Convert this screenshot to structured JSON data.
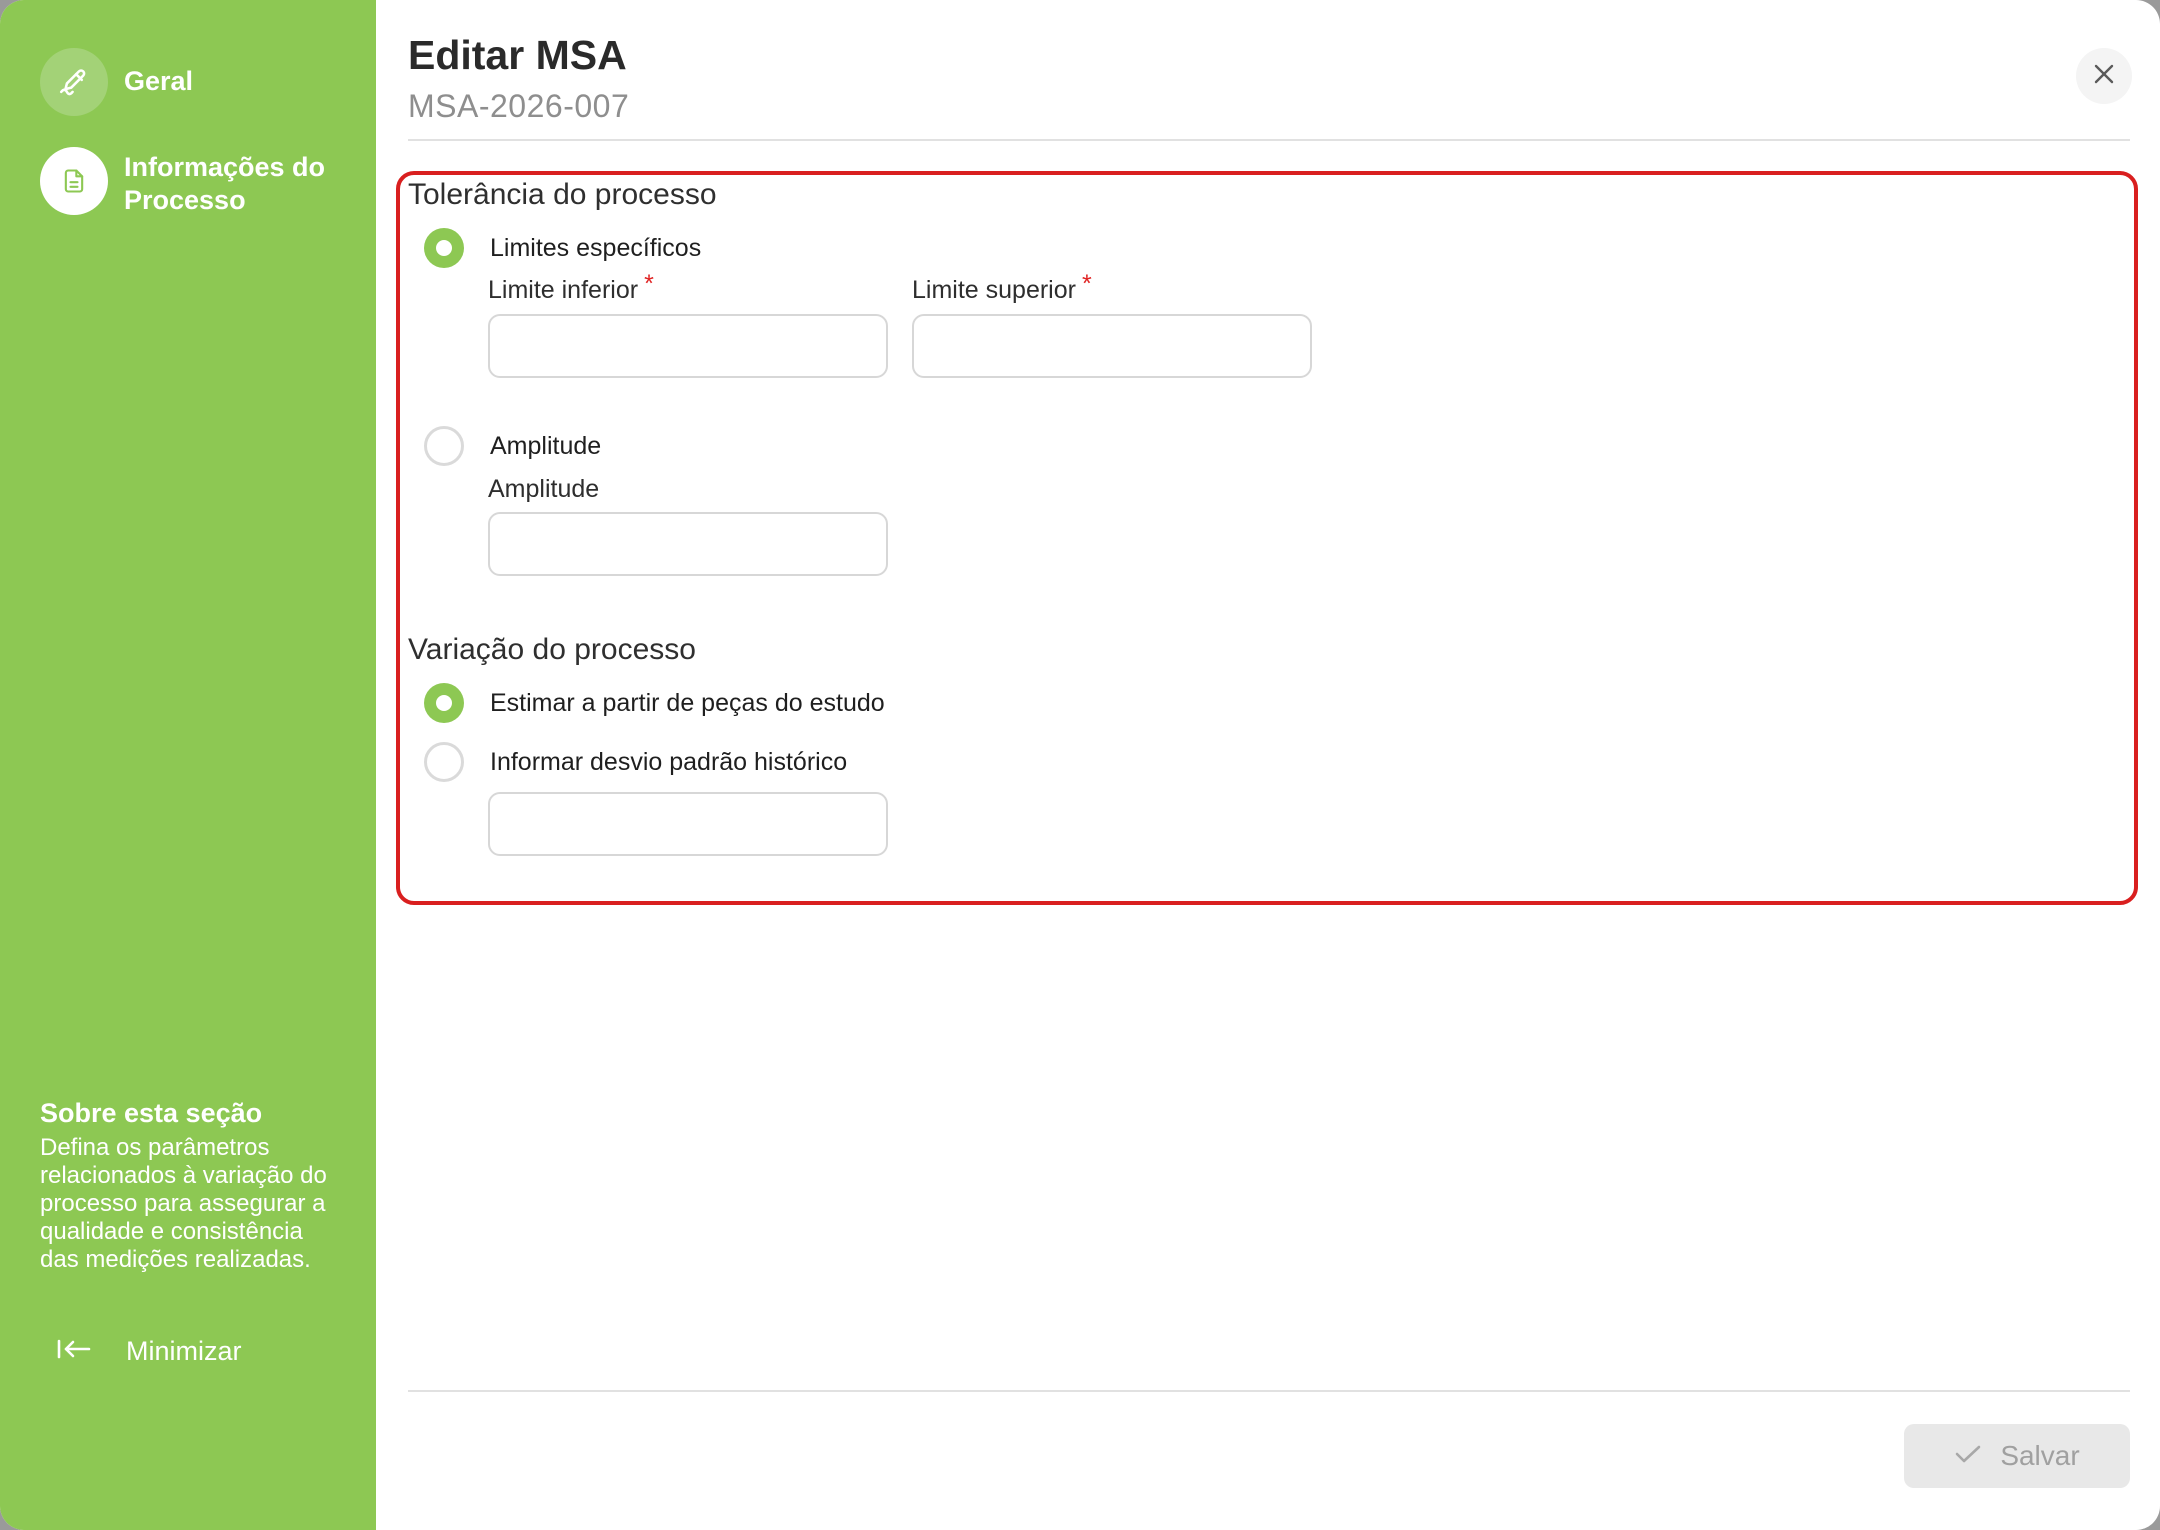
{
  "sidebar": {
    "items": [
      {
        "label": "Geral",
        "icon": "pencil-check-icon",
        "state": "done"
      },
      {
        "label": "Informações do Processo",
        "icon": "document-icon",
        "state": "active"
      }
    ],
    "about_title": "Sobre esta seção",
    "about_text": "Defina os parâmetros relacionados à variação do processo para assegurar a qualidade e consistência das medições realizadas.",
    "minimize_label": "Minimizar"
  },
  "header": {
    "title": "Editar MSA",
    "subtitle": "MSA-2026-007"
  },
  "tolerance": {
    "title": "Tolerância do processo",
    "option_limits": "Limites específicos",
    "lower_label": "Limite inferior",
    "upper_label": "Limite superior",
    "required_mark": "*",
    "lower_value": "",
    "upper_value": "",
    "option_amplitude": "Amplitude",
    "amplitude_label": "Amplitude",
    "amplitude_value": "",
    "selected": "limits"
  },
  "variation": {
    "title": "Variação do processo",
    "option_estimate": "Estimar a partir de peças do estudo",
    "option_historical": "Informar desvio padrão histórico",
    "historical_value": "",
    "selected": "estimate"
  },
  "footer": {
    "save_label": "Salvar",
    "save_enabled": false
  },
  "colors": {
    "accent": "#8dc853",
    "highlight": "#d91f1f",
    "required": "#e02424"
  }
}
